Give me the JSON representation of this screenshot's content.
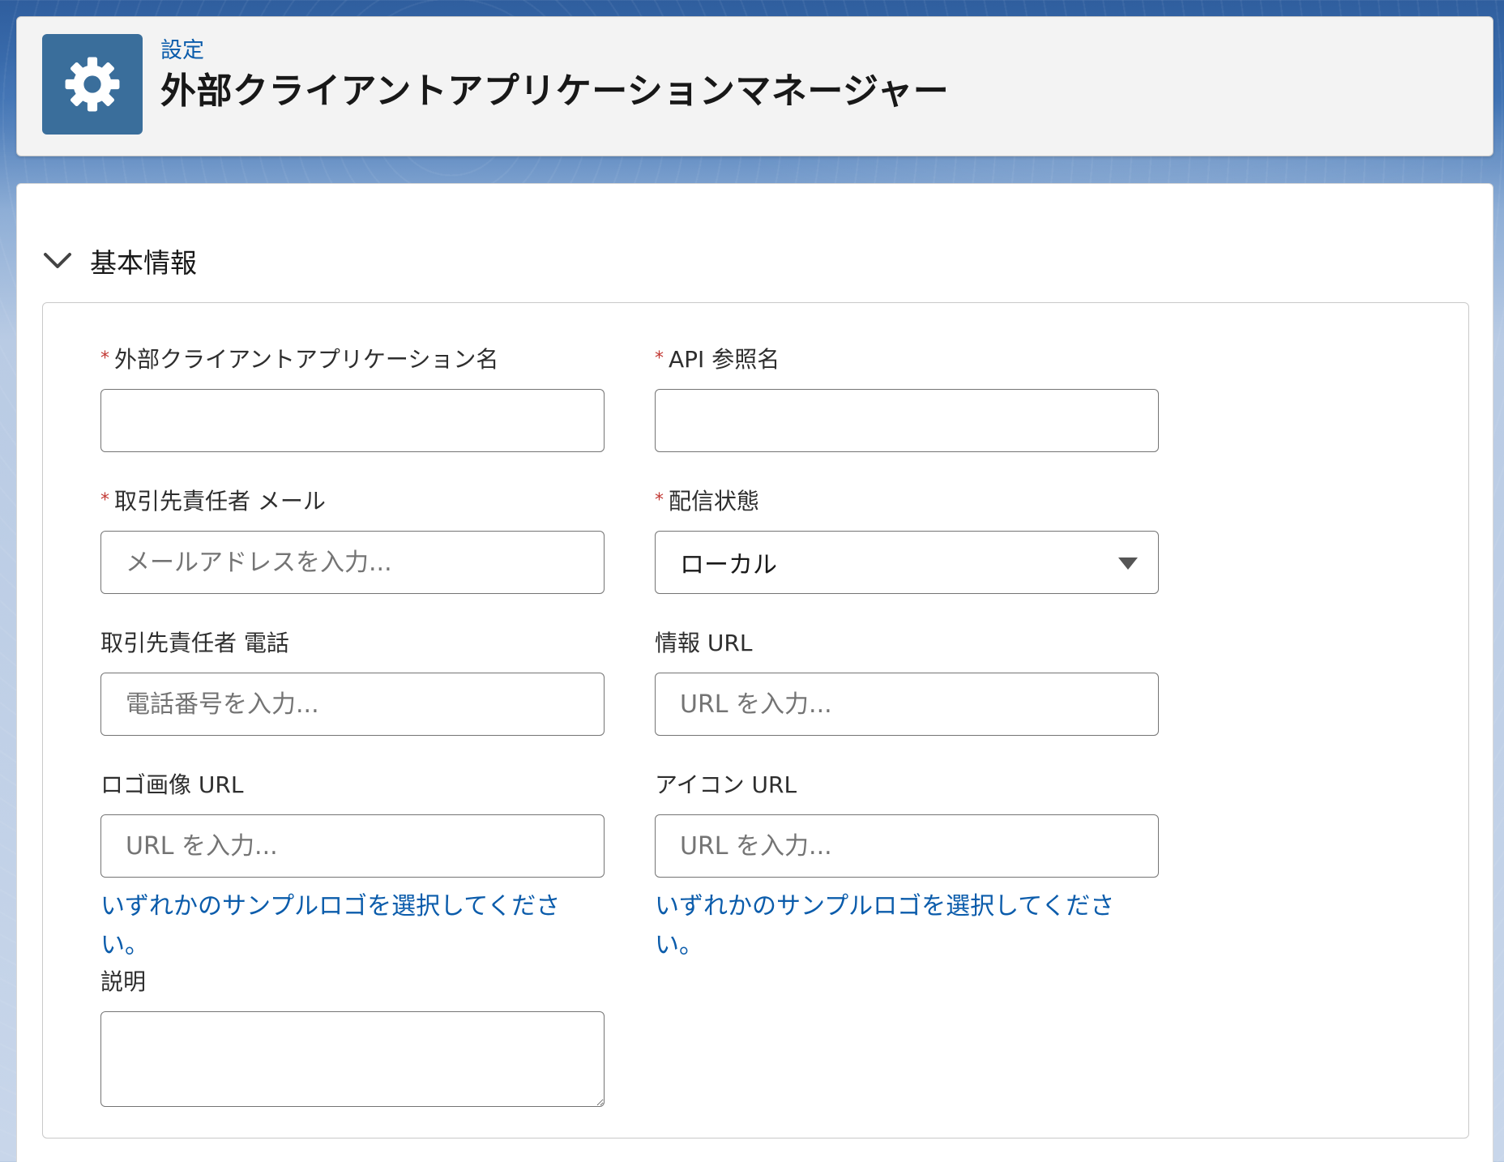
{
  "header": {
    "breadcrumb": "設定",
    "title": "外部クライアントアプリケーションマネージャー",
    "icon": "gear-icon",
    "icon_bg": "#3a6e9b"
  },
  "section": {
    "title": "基本情報",
    "expanded": true
  },
  "required_marker": "*",
  "fields": {
    "app_name": {
      "label": "外部クライアントアプリケーション名",
      "required": true,
      "value": "",
      "placeholder": ""
    },
    "api_name": {
      "label": "API 参照名",
      "required": true,
      "value": "",
      "placeholder": ""
    },
    "contact_email": {
      "label": "取引先責任者 メール",
      "required": true,
      "value": "",
      "placeholder": "メールアドレスを入力..."
    },
    "distribution_state": {
      "label": "配信状態",
      "required": true,
      "selected": "ローカル"
    },
    "contact_phone": {
      "label": "取引先責任者 電話",
      "required": false,
      "value": "",
      "placeholder": "電話番号を入力..."
    },
    "info_url": {
      "label": "情報 URL",
      "required": false,
      "value": "",
      "placeholder": "URL を入力..."
    },
    "logo_url": {
      "label": "ロゴ画像 URL",
      "required": false,
      "value": "",
      "placeholder": "URL を入力...",
      "help_link": "いずれかのサンプルロゴを選択してください。"
    },
    "icon_url": {
      "label": "アイコン URL",
      "required": false,
      "value": "",
      "placeholder": "URL を入力...",
      "help_link": "いずれかのサンプルロゴを選択してください。"
    },
    "description": {
      "label": "説明",
      "required": false,
      "value": "",
      "placeholder": ""
    }
  },
  "colors": {
    "link": "#0b5cab",
    "required": "#c23934",
    "border": "#747474"
  }
}
